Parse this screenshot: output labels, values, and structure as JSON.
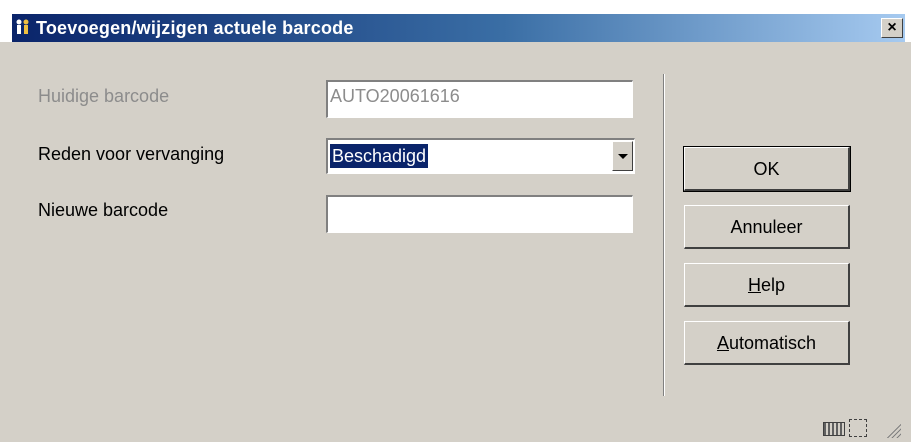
{
  "window": {
    "title": "Toevoegen/wijzigen actuele barcode",
    "close_glyph": "×",
    "app_icon": "people-icon"
  },
  "form": {
    "current_barcode": {
      "label": "Huidige barcode",
      "value": "AUTO20061616",
      "disabled": true
    },
    "reason": {
      "label": "Reden voor vervanging",
      "selected": "Beschadigd"
    },
    "new_barcode": {
      "label": "Nieuwe barcode",
      "value": ""
    }
  },
  "buttons": {
    "ok": "OK",
    "cancel": "Annuleer",
    "help_first": "H",
    "help_rest": "elp",
    "auto_first": "A",
    "auto_rest": "utomatisch"
  },
  "status_icons": [
    "keyboard-icon",
    "resize-icon",
    "size-grip-icon"
  ]
}
